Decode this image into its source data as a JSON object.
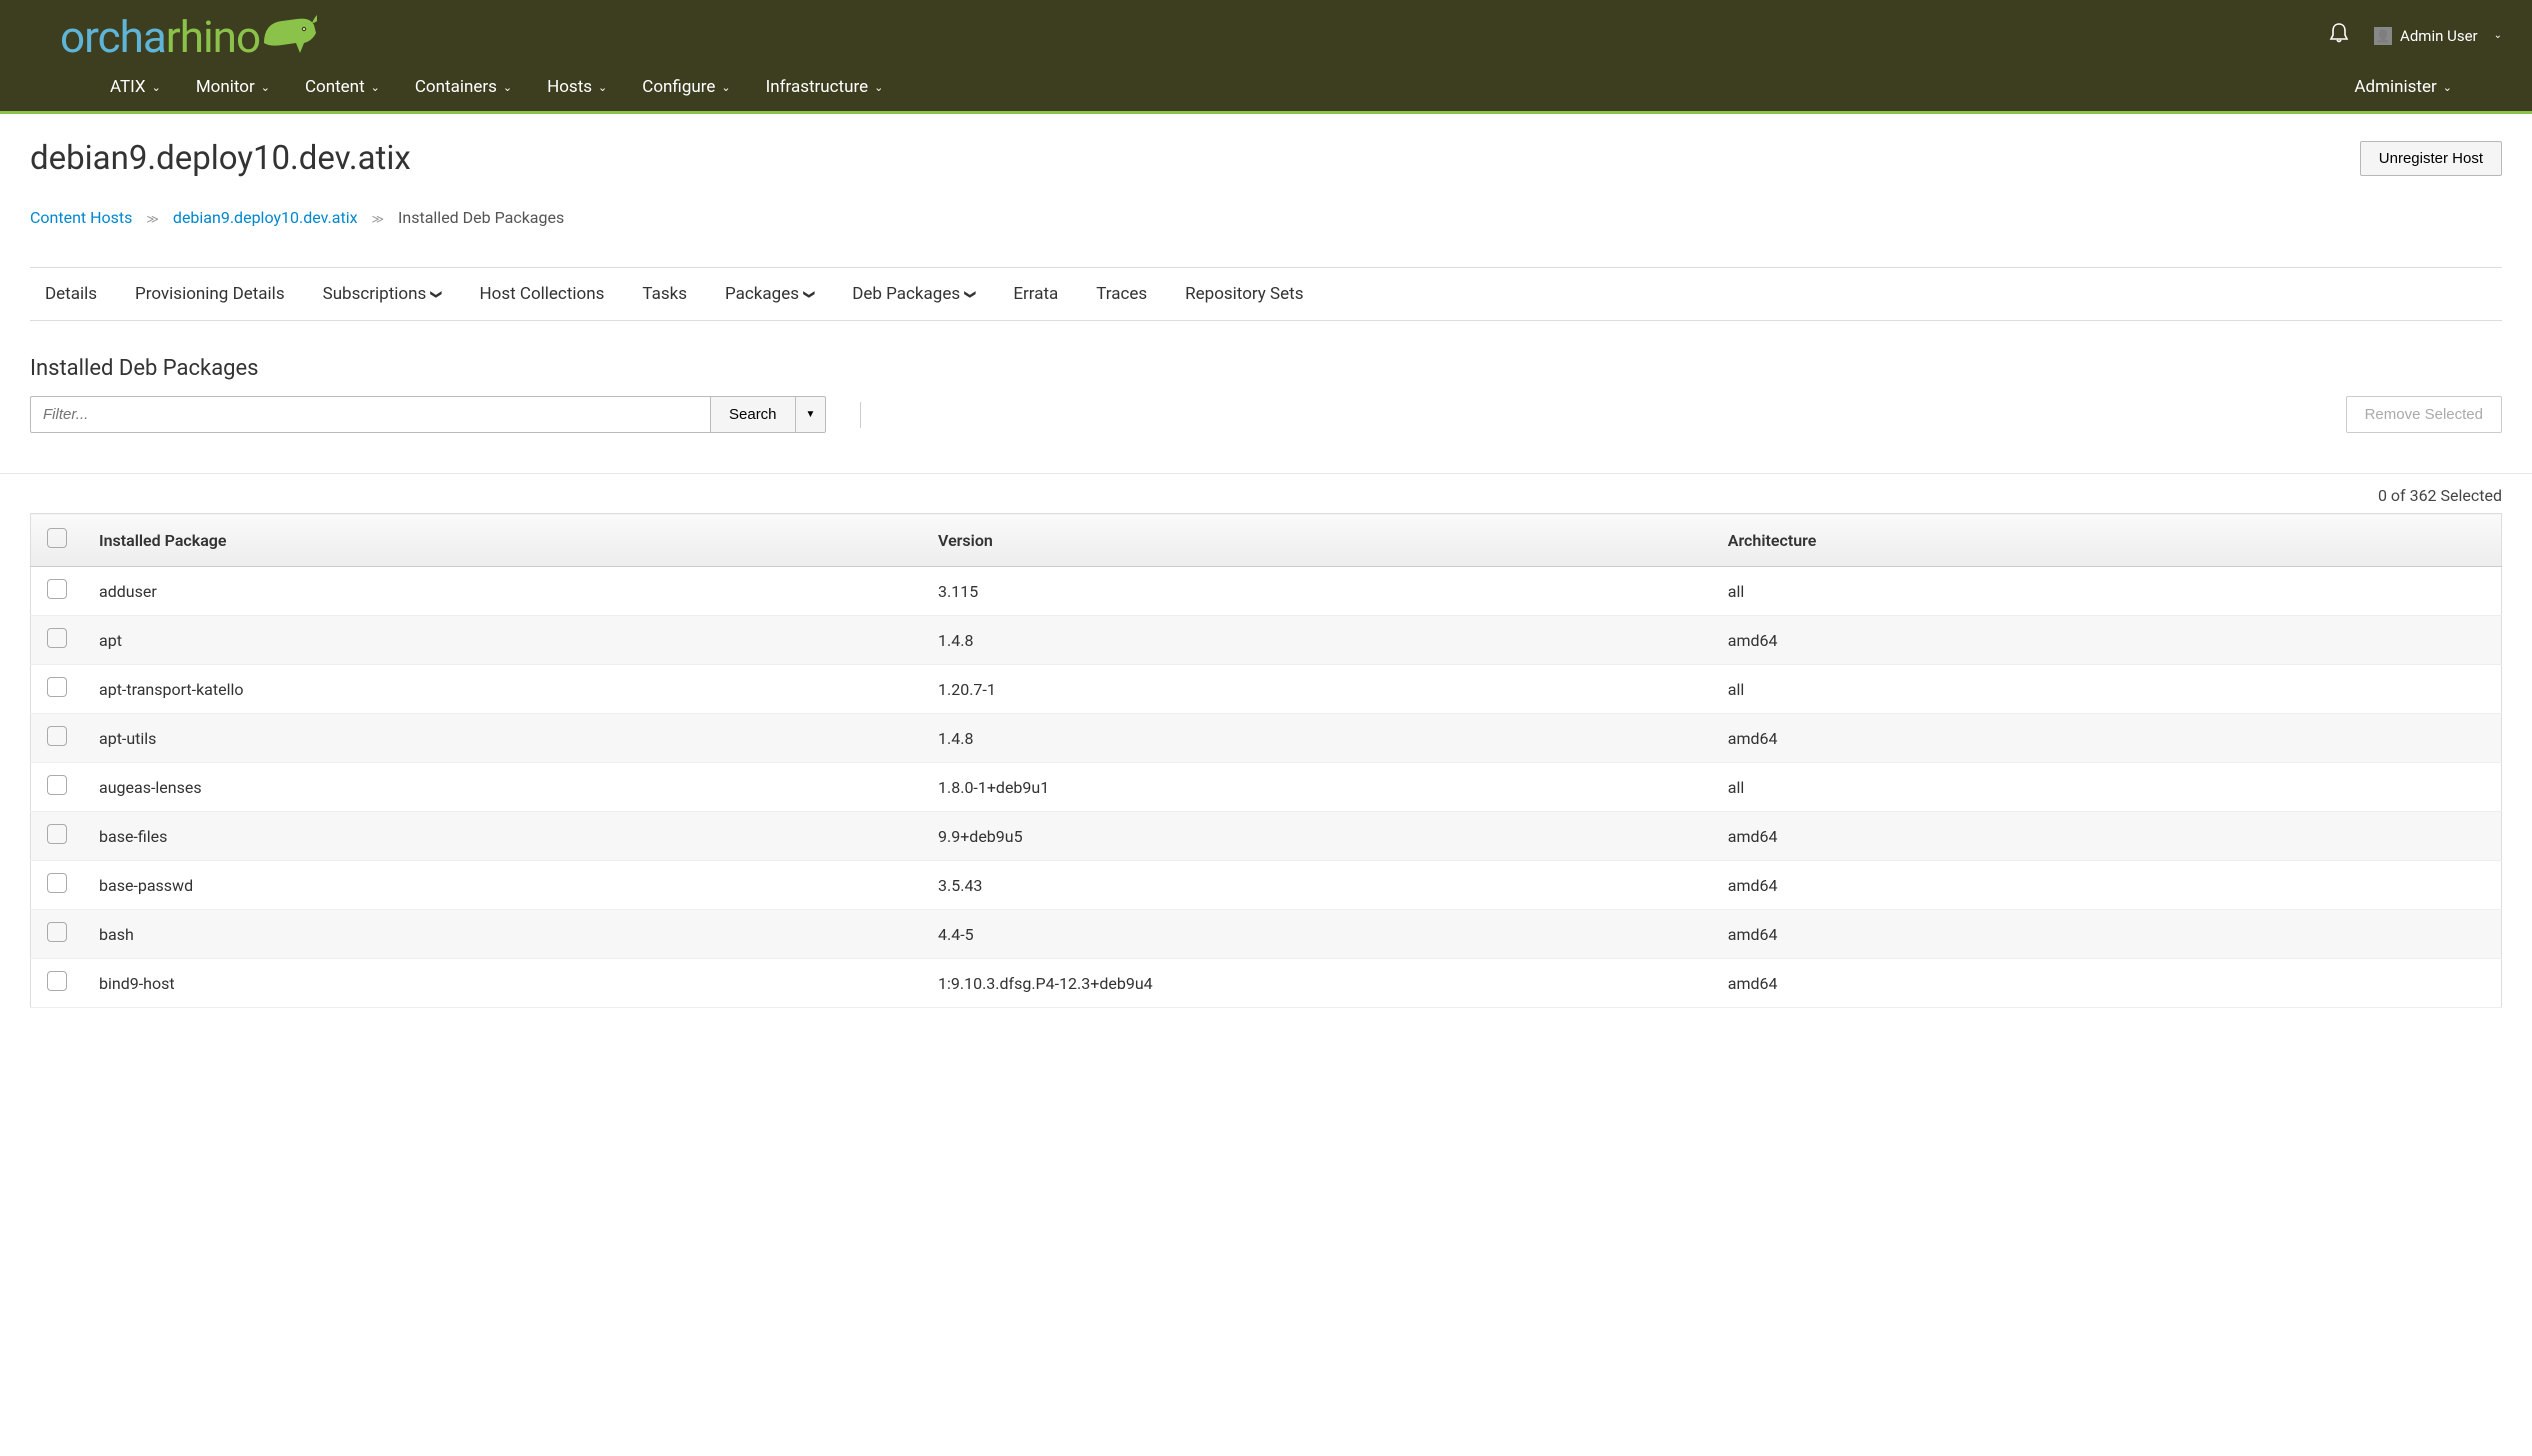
{
  "brand": {
    "part1": "orcha",
    "part2": "rhino"
  },
  "user": {
    "name": "Admin User"
  },
  "nav": {
    "left": [
      {
        "label": "ATIX",
        "dropdown": true
      },
      {
        "label": "Monitor",
        "dropdown": true
      },
      {
        "label": "Content",
        "dropdown": true
      },
      {
        "label": "Containers",
        "dropdown": true
      },
      {
        "label": "Hosts",
        "dropdown": true
      },
      {
        "label": "Configure",
        "dropdown": true
      },
      {
        "label": "Infrastructure",
        "dropdown": true
      }
    ],
    "right": [
      {
        "label": "Administer",
        "dropdown": true
      }
    ]
  },
  "page": {
    "title": "debian9.deploy10.dev.atix",
    "unregister_label": "Unregister Host"
  },
  "breadcrumb": {
    "link1": "Content Hosts",
    "link2": "debian9.deploy10.dev.atix",
    "current": "Installed Deb Packages"
  },
  "tabs": [
    {
      "label": "Details",
      "dropdown": false
    },
    {
      "label": "Provisioning Details",
      "dropdown": false
    },
    {
      "label": "Subscriptions",
      "dropdown": true
    },
    {
      "label": "Host Collections",
      "dropdown": false
    },
    {
      "label": "Tasks",
      "dropdown": false
    },
    {
      "label": "Packages",
      "dropdown": true
    },
    {
      "label": "Deb Packages",
      "dropdown": true
    },
    {
      "label": "Errata",
      "dropdown": false
    },
    {
      "label": "Traces",
      "dropdown": false
    },
    {
      "label": "Repository Sets",
      "dropdown": false
    }
  ],
  "section": {
    "title": "Installed Deb Packages"
  },
  "filter": {
    "placeholder": "Filter...",
    "search_label": "Search",
    "remove_label": "Remove Selected"
  },
  "selection": {
    "text": "0 of 362 Selected"
  },
  "table": {
    "headers": {
      "package": "Installed Package",
      "version": "Version",
      "arch": "Architecture"
    },
    "rows": [
      {
        "package": "adduser",
        "version": "3.115",
        "arch": "all"
      },
      {
        "package": "apt",
        "version": "1.4.8",
        "arch": "amd64"
      },
      {
        "package": "apt-transport-katello",
        "version": "1.20.7-1",
        "arch": "all"
      },
      {
        "package": "apt-utils",
        "version": "1.4.8",
        "arch": "amd64"
      },
      {
        "package": "augeas-lenses",
        "version": "1.8.0-1+deb9u1",
        "arch": "all"
      },
      {
        "package": "base-files",
        "version": "9.9+deb9u5",
        "arch": "amd64"
      },
      {
        "package": "base-passwd",
        "version": "3.5.43",
        "arch": "amd64"
      },
      {
        "package": "bash",
        "version": "4.4-5",
        "arch": "amd64"
      },
      {
        "package": "bind9-host",
        "version": "1:9.10.3.dfsg.P4-12.3+deb9u4",
        "arch": "amd64"
      }
    ]
  }
}
